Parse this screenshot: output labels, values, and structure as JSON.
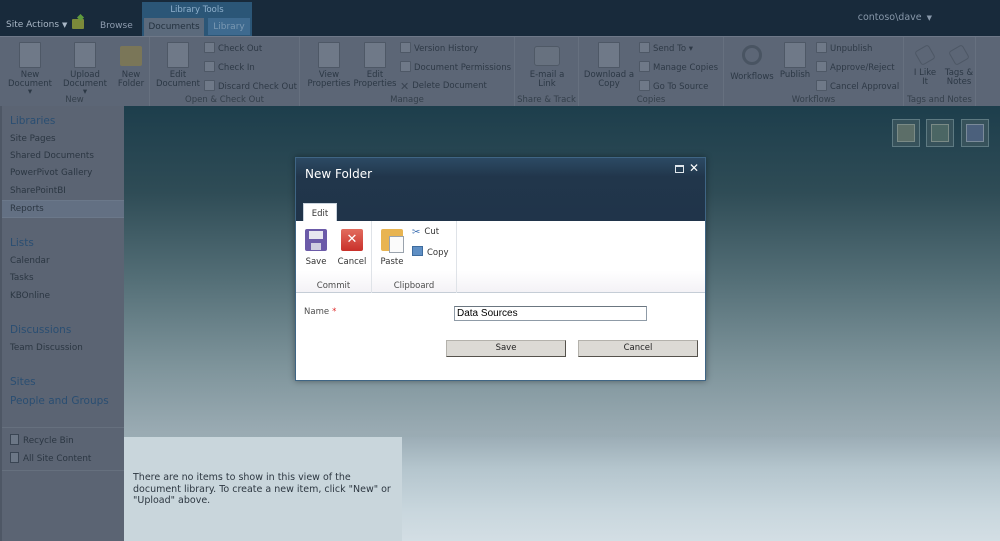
{
  "topbar": {
    "site_actions": "Site Actions",
    "browse_tab": "Browse",
    "contextual_group": "Library Tools",
    "tabs": [
      {
        "label": "Documents",
        "selected": true
      },
      {
        "label": "Library",
        "selected": false
      }
    ],
    "user": "contoso\\dave"
  },
  "ribbon": {
    "groups": [
      {
        "label": "New",
        "large": [
          "New Document",
          "Upload Document",
          "New Folder"
        ]
      },
      {
        "label": "Open & Check Out",
        "large": [
          "Edit Document"
        ],
        "small": [
          "Check Out",
          "Check In",
          "Discard Check Out"
        ]
      },
      {
        "label": "Manage",
        "large": [
          "View Properties",
          "Edit Properties"
        ],
        "small": [
          "Version History",
          "Document Permissions",
          "Delete Document"
        ]
      },
      {
        "label": "Share & Track",
        "large": [
          "E-mail a Link"
        ]
      },
      {
        "label": "Copies",
        "large": [
          "Download a Copy"
        ],
        "small": [
          "Send To",
          "Manage Copies",
          "Go To Source"
        ]
      },
      {
        "label": "Workflows",
        "large": [
          "Workflows",
          "Publish"
        ],
        "small": [
          "Unpublish",
          "Approve/Reject",
          "Cancel Approval"
        ]
      },
      {
        "label": "Tags and Notes",
        "large": [
          "I Like It",
          "Tags & Notes"
        ]
      }
    ],
    "new_document_l1": "New",
    "new_document_l2": "Document",
    "upload_document_l1": "Upload",
    "upload_document_l2": "Document",
    "new_folder_l1": "New",
    "new_folder_l2": "Folder",
    "edit_document_l1": "Edit",
    "edit_document_l2": "Document",
    "view_properties_l1": "View",
    "view_properties_l2": "Properties",
    "edit_properties_l1": "Edit",
    "edit_properties_l2": "Properties",
    "email_link_l1": "E-mail a",
    "email_link_l2": "Link",
    "download_copy_l1": "Download a",
    "download_copy_l2": "Copy",
    "i_like_it_l1": "I Like",
    "i_like_it_l2": "It",
    "tags_notes_l1": "Tags &",
    "tags_notes_l2": "Notes"
  },
  "leftnav": {
    "sections": [
      {
        "heading": "Libraries",
        "items": [
          "Site Pages",
          "Shared Documents",
          "PowerPivot Gallery",
          "SharePointBI",
          "Reports"
        ]
      },
      {
        "heading": "Lists",
        "items": [
          "Calendar",
          "Tasks",
          "KBOnline"
        ]
      },
      {
        "heading": "Discussions",
        "items": [
          "Team Discussion"
        ]
      },
      {
        "heading": "Sites",
        "items": []
      },
      {
        "heading": "People and Groups",
        "items": []
      }
    ],
    "selected": "Reports",
    "footer": [
      "Recycle Bin",
      "All Site Content"
    ]
  },
  "main": {
    "empty_message": "There are no items to show in this view of the document library. To create a new item, click \"New\" or \"Upload\" above.",
    "view_icons": [
      "excel-view-icon",
      "chart-view-icon",
      "calendar-view-icon"
    ]
  },
  "dialog": {
    "title": "New Folder",
    "tab": "Edit",
    "groups": [
      {
        "label": "Commit",
        "buttons": [
          "Save",
          "Cancel"
        ]
      },
      {
        "label": "Clipboard",
        "buttons": [
          "Paste",
          "Cut",
          "Copy"
        ]
      }
    ],
    "field_label": "Name",
    "required_marker": "*",
    "name_value": "Data Sources",
    "save_label": "Save",
    "cancel_label": "Cancel"
  }
}
